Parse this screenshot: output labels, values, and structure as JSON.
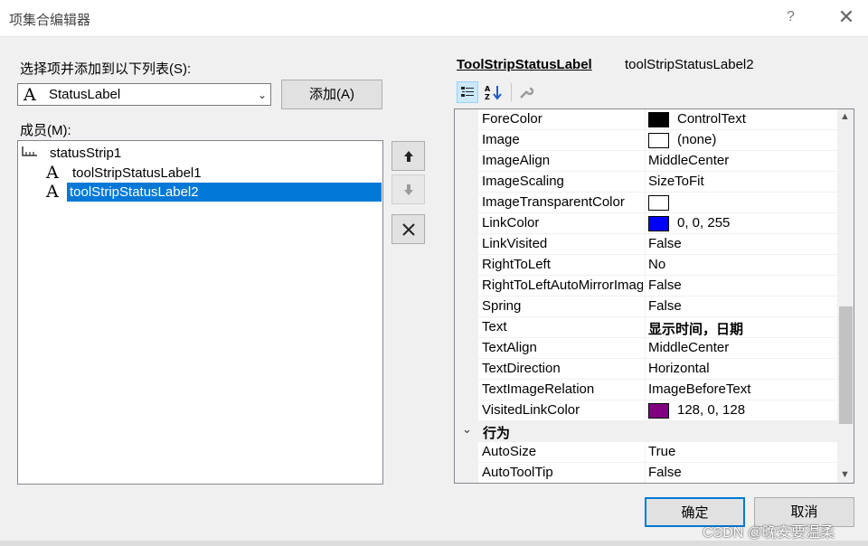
{
  "window": {
    "title": "项集合编辑器",
    "help": "?",
    "close": "✕"
  },
  "left": {
    "select_label": "选择项并添加到以下列表(S):",
    "combo_value": "StatusLabel",
    "add_button": "添加(A)",
    "members_label": "成员(M):",
    "members": [
      {
        "label": "statusStrip1",
        "level": 0,
        "icon": "status-strip-icon",
        "selected": false
      },
      {
        "label": "toolStripStatusLabel1",
        "level": 1,
        "icon": "label-icon",
        "selected": false
      },
      {
        "label": "toolStripStatusLabel2",
        "level": 1,
        "icon": "label-icon",
        "selected": true
      }
    ]
  },
  "props": {
    "type_name": "ToolStripStatusLabel",
    "instance_name": "toolStripStatusLabel2",
    "rows": [
      {
        "name": "ForeColor",
        "value": "ControlText",
        "swatch": "#000000"
      },
      {
        "name": "Image",
        "value": "(none)",
        "swatch": "#ffffff"
      },
      {
        "name": "ImageAlign",
        "value": "MiddleCenter"
      },
      {
        "name": "ImageScaling",
        "value": "SizeToFit"
      },
      {
        "name": "ImageTransparentColor",
        "value": "",
        "swatch": "#ffffff"
      },
      {
        "name": "LinkColor",
        "value": "0, 0, 255",
        "swatch": "#0000ff"
      },
      {
        "name": "LinkVisited",
        "value": "False"
      },
      {
        "name": "RightToLeft",
        "value": "No"
      },
      {
        "name": "RightToLeftAutoMirrorImage",
        "value": "False"
      },
      {
        "name": "Spring",
        "value": "False"
      },
      {
        "name": "Text",
        "value": "显示时间，日期",
        "bold": true
      },
      {
        "name": "TextAlign",
        "value": "MiddleCenter"
      },
      {
        "name": "TextDirection",
        "value": "Horizontal"
      },
      {
        "name": "TextImageRelation",
        "value": "ImageBeforeText"
      },
      {
        "name": "VisitedLinkColor",
        "value": "128, 0, 128",
        "swatch": "#800080"
      }
    ],
    "category": "行为",
    "rows2": [
      {
        "name": "AutoSize",
        "value": "True"
      },
      {
        "name": "AutoToolTip",
        "value": "False"
      }
    ]
  },
  "footer": {
    "ok": "确定",
    "cancel": "取消",
    "watermark": "CSDN @晚安要温柔"
  }
}
